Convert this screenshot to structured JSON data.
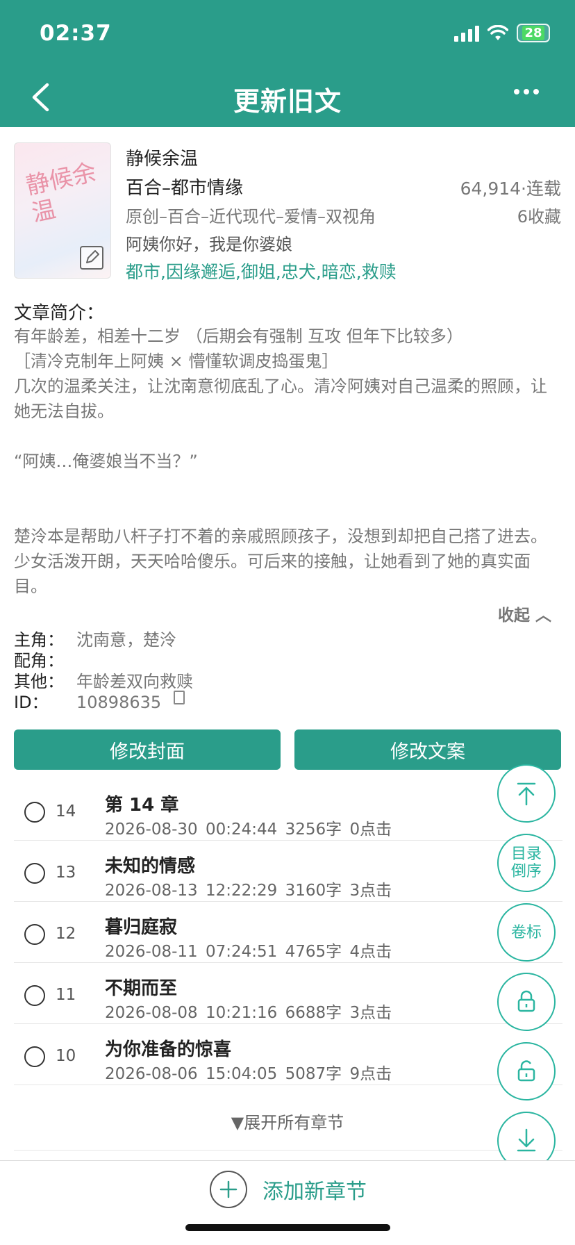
{
  "status": {
    "time": "02:37",
    "battery": "28"
  },
  "header": {
    "title": "更新旧文"
  },
  "book": {
    "title": "静候余温",
    "category": "百合–都市情缘",
    "words_status": "64,914·连载",
    "genre": "原创–百合–近代现代–爱情–双视角",
    "favorites": "6收藏",
    "slogan": "阿姨你好，我是你婆娘",
    "tags": "都市,因缘邂逅,御姐,忠犬,暗恋,救赎",
    "cover_text": "静候余温"
  },
  "intro": {
    "label": "文章简介：",
    "paragraphs": [
      "有年龄差，相差十二岁 （后期会有强制 互攻 但年下比较多）",
      "［清冷克制年上阿姨 × 懵懂软调皮捣蛋鬼］",
      "几次的温柔关注，让沈南意彻底乱了心。清冷阿姨对自己温柔的照顾，让她无法自拔。",
      "“阿姨…俺婆娘当不当？”",
      "楚泠本是帮助八杆子打不着的亲戚照顾孩子，没想到却把自己搭了进去。少女活泼开朗，天天哈哈傻乐。可后来的接触，让她看到了她的真实面目。"
    ],
    "collapse": "收起 ︿"
  },
  "roles": {
    "main_key": "主角：",
    "main_val": "沈南意，楚泠",
    "support_key": "配角：",
    "support_val": "",
    "other_key": "其他：",
    "other_val": "年龄差双向救赎",
    "id_key": "ID：",
    "id_val": "10898635"
  },
  "buttons": {
    "edit_cover": "修改封面",
    "edit_desc": "修改文案"
  },
  "chapters": [
    {
      "num": "14",
      "name": "第 14 章",
      "date": "2026-08-30 00:24:44",
      "words": "3256字",
      "clicks": "0点击"
    },
    {
      "num": "13",
      "name": "未知的情感",
      "date": "2026-08-13 12:22:29",
      "words": "3160字",
      "clicks": "3点击"
    },
    {
      "num": "12",
      "name": "暮归庭寂",
      "date": "2026-08-11 07:24:51",
      "words": "4765字",
      "clicks": "4点击"
    },
    {
      "num": "11",
      "name": "不期而至",
      "date": "2026-08-08 10:21:16",
      "words": "6688字",
      "clicks": "3点击"
    },
    {
      "num": "10",
      "name": "为你准备的惊喜",
      "date": "2026-08-06 15:04:05",
      "words": "5087字",
      "clicks": "9点击"
    }
  ],
  "expand_all": "▼展开所有章节",
  "fab": {
    "toc_reverse_1": "目录",
    "toc_reverse_2": "倒序",
    "volume": "卷标"
  },
  "bottom": {
    "add_chapter": "添加新章节"
  },
  "colors": {
    "primary": "#2a9d8a",
    "accent": "#2ab5a0"
  }
}
